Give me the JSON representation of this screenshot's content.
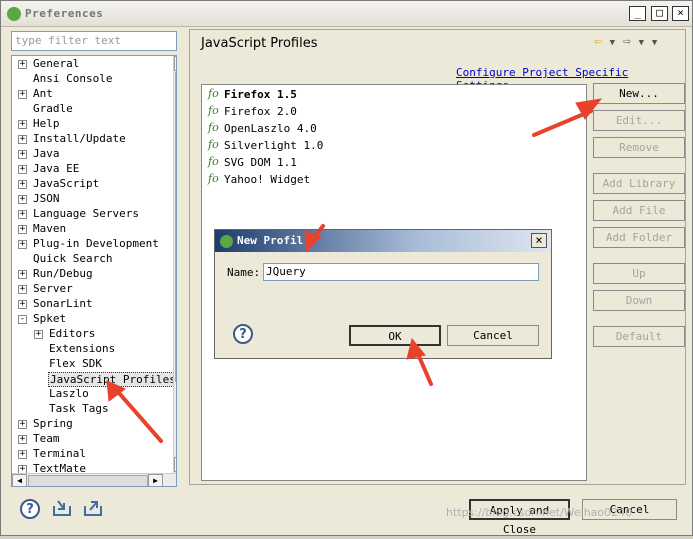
{
  "window": {
    "title": "Preferences",
    "min": "_",
    "max": "□",
    "close": "×"
  },
  "filter": {
    "placeholder": "type filter text"
  },
  "tree": [
    {
      "label": "General",
      "exp": "+",
      "indent": 0
    },
    {
      "label": "Ansi Console",
      "exp": "",
      "indent": 0
    },
    {
      "label": "Ant",
      "exp": "+",
      "indent": 0
    },
    {
      "label": "Gradle",
      "exp": "",
      "indent": 0
    },
    {
      "label": "Help",
      "exp": "+",
      "indent": 0
    },
    {
      "label": "Install/Update",
      "exp": "+",
      "indent": 0
    },
    {
      "label": "Java",
      "exp": "+",
      "indent": 0
    },
    {
      "label": "Java EE",
      "exp": "+",
      "indent": 0
    },
    {
      "label": "JavaScript",
      "exp": "+",
      "indent": 0
    },
    {
      "label": "JSON",
      "exp": "+",
      "indent": 0
    },
    {
      "label": "Language Servers",
      "exp": "+",
      "indent": 0
    },
    {
      "label": "Maven",
      "exp": "+",
      "indent": 0
    },
    {
      "label": "Plug-in Development",
      "exp": "+",
      "indent": 0
    },
    {
      "label": "Quick Search",
      "exp": "",
      "indent": 0
    },
    {
      "label": "Run/Debug",
      "exp": "+",
      "indent": 0
    },
    {
      "label": "Server",
      "exp": "+",
      "indent": 0
    },
    {
      "label": "SonarLint",
      "exp": "+",
      "indent": 0
    },
    {
      "label": "Spket",
      "exp": "-",
      "indent": 0
    },
    {
      "label": "Editors",
      "exp": "+",
      "indent": 1
    },
    {
      "label": "Extensions",
      "exp": "",
      "indent": 1
    },
    {
      "label": "Flex SDK",
      "exp": "",
      "indent": 1
    },
    {
      "label": "JavaScript Profiles",
      "exp": "",
      "indent": 1,
      "selected": true
    },
    {
      "label": "Laszlo",
      "exp": "",
      "indent": 1
    },
    {
      "label": "Task Tags",
      "exp": "",
      "indent": 1
    },
    {
      "label": "Spring",
      "exp": "+",
      "indent": 0
    },
    {
      "label": "Team",
      "exp": "+",
      "indent": 0
    },
    {
      "label": "Terminal",
      "exp": "+",
      "indent": 0
    },
    {
      "label": "TextMate",
      "exp": "+",
      "indent": 0
    }
  ],
  "page": {
    "title": "JavaScript Profiles",
    "link": "Configure Project Specific Settings..."
  },
  "profiles": [
    "Firefox 1.5",
    "Firefox 2.0",
    "OpenLaszlo 4.0",
    "Silverlight 1.0",
    "SVG DOM 1.1",
    "Yahoo! Widget"
  ],
  "buttons": {
    "new": "New...",
    "edit": "Edit...",
    "remove": "Remove",
    "add_library": "Add Library",
    "add_file": "Add File",
    "add_folder": "Add Folder",
    "up": "Up",
    "down": "Down",
    "default": "Default"
  },
  "dialog": {
    "title": "New Profil",
    "name_label": "Name:",
    "name_value": "JQuery",
    "ok": "OK",
    "cancel": "Cancel"
  },
  "footer": {
    "apply_close": "Apply and Close",
    "cancel": "Cancel"
  },
  "watermark": "https://blog.csdn.net/Weihao0240",
  "colors": {
    "arrow": "#e8412c",
    "link": "#0000cc",
    "accent": "#5aa845"
  }
}
